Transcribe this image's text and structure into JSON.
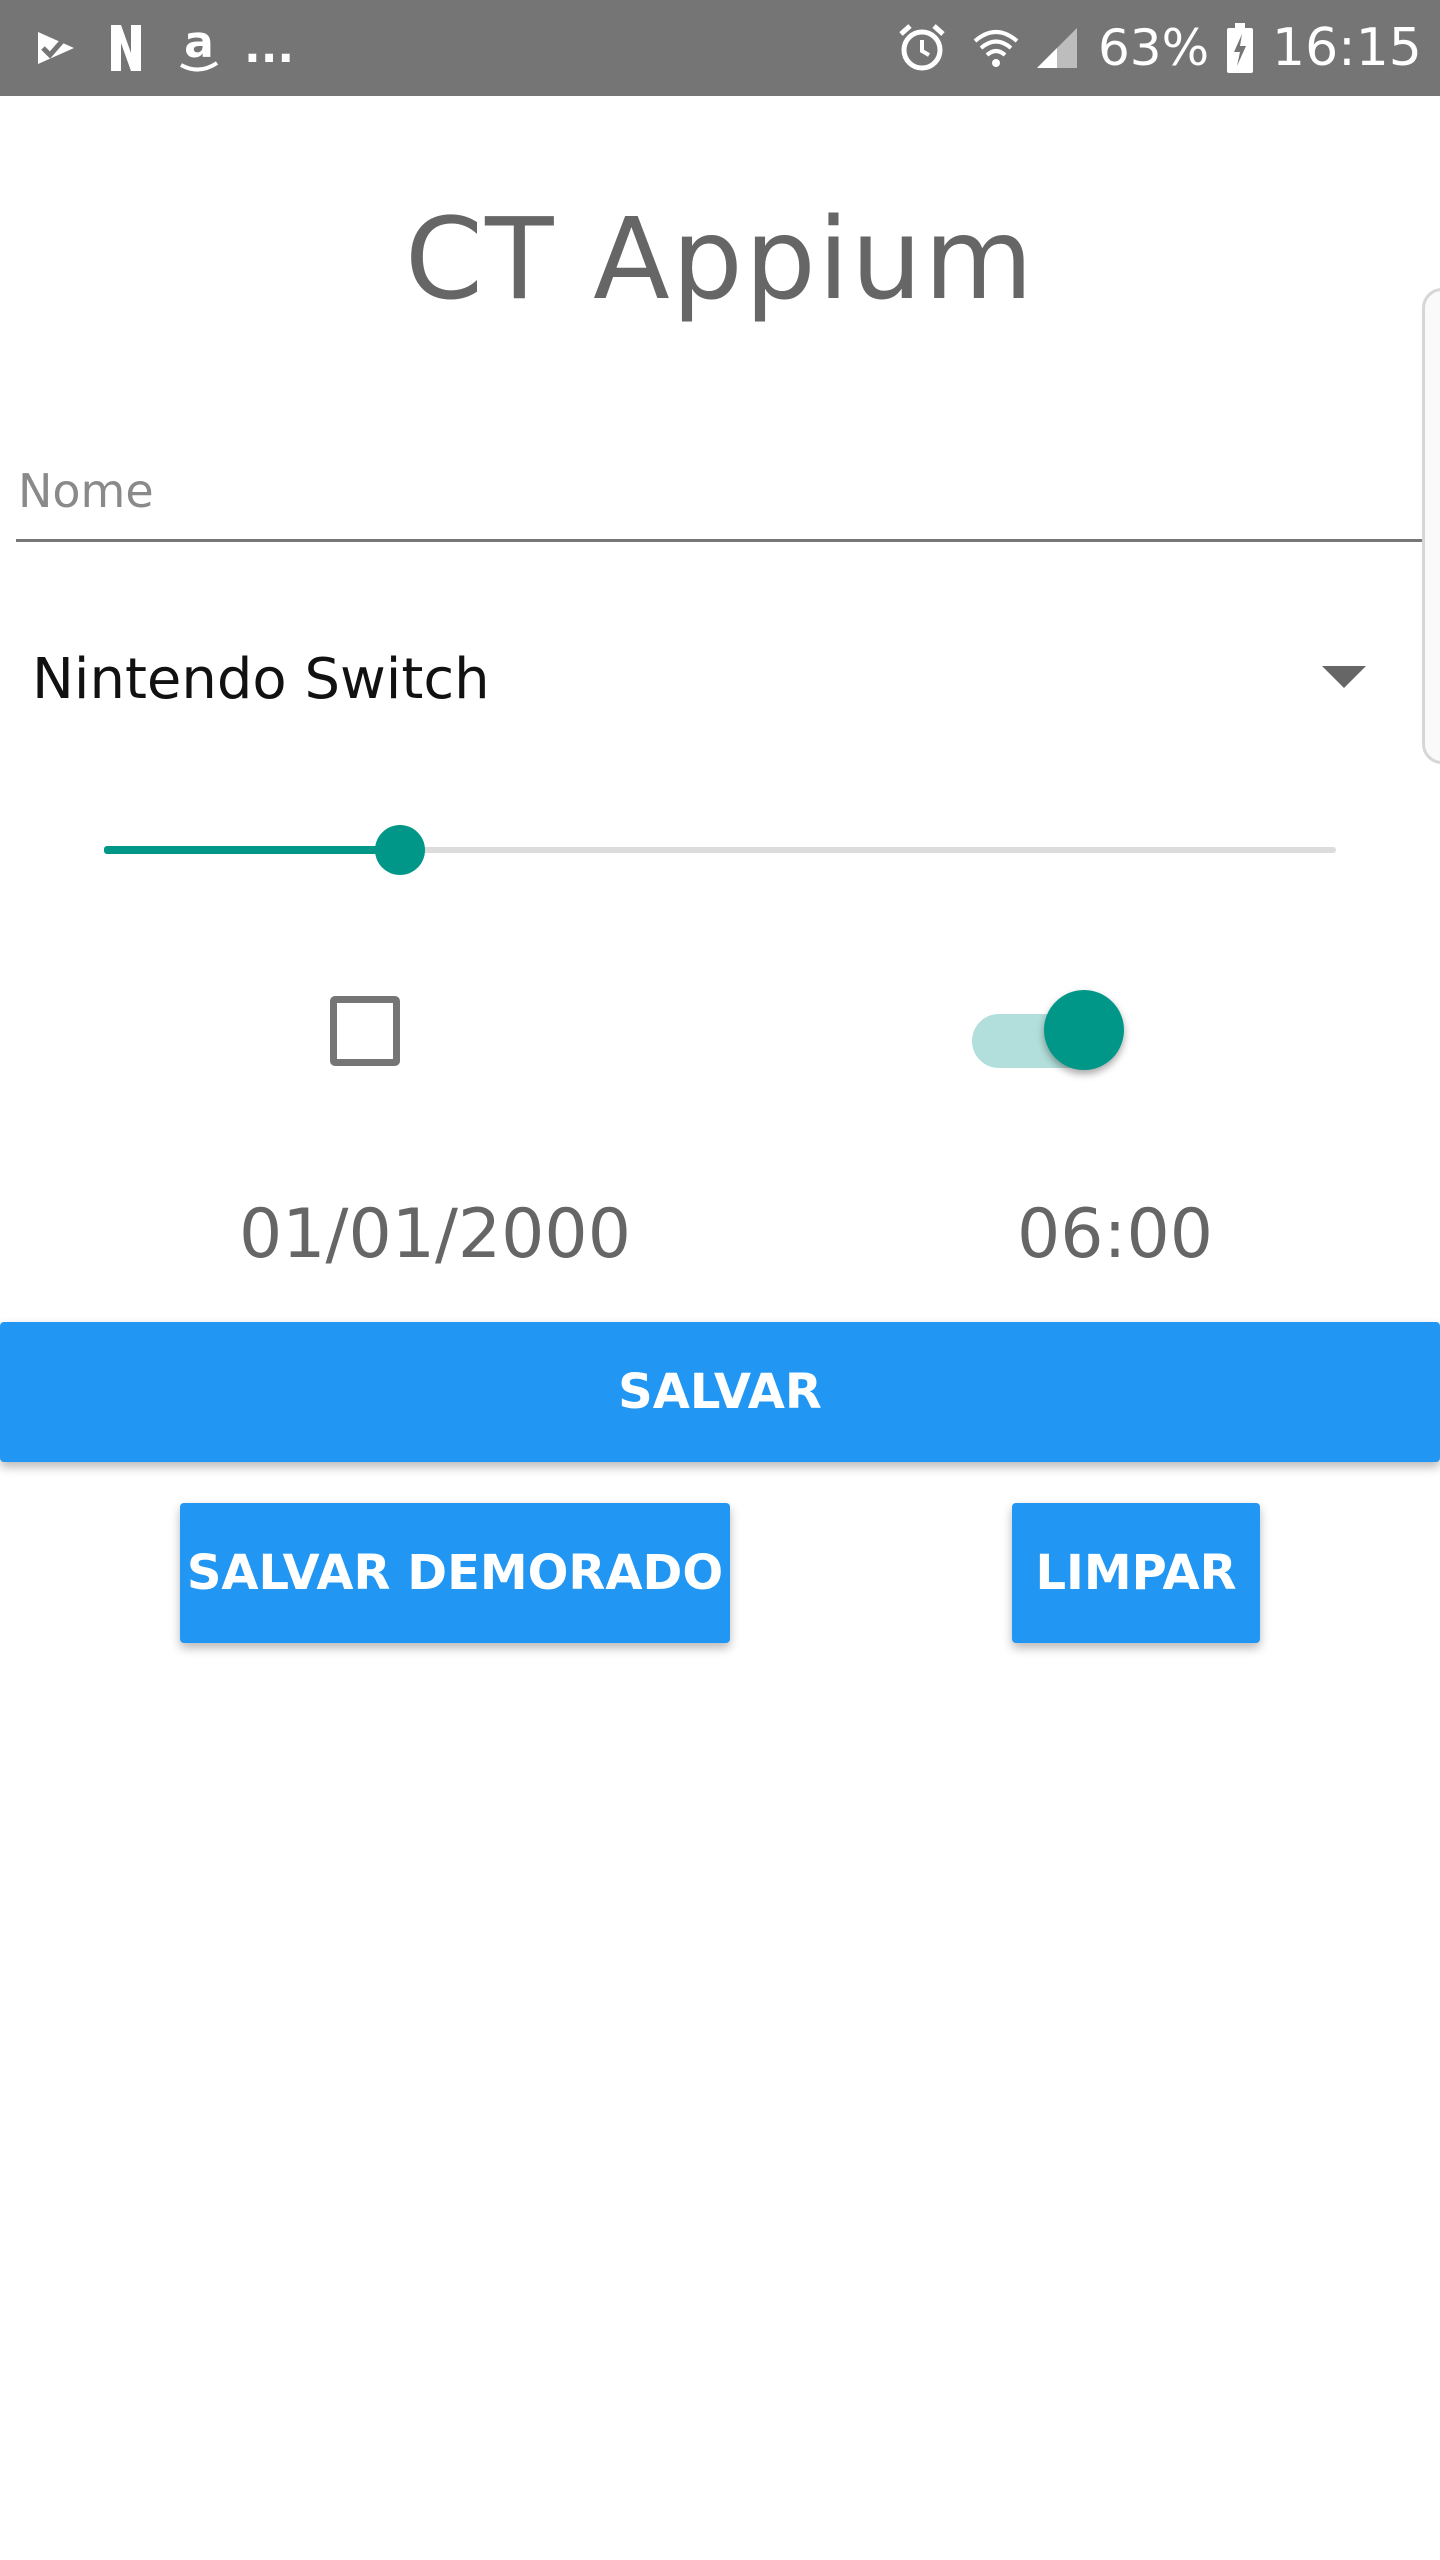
{
  "status_bar": {
    "notification_icons": [
      "check-notification-icon",
      "n-app-icon",
      "amazon-icon"
    ],
    "more_indicator": "...",
    "alarm_icon": "alarm-icon",
    "wifi_icon": "wifi-icon",
    "signal_icon": "signal-icon",
    "battery_percent": "63%",
    "battery_icon": "battery-charging-icon",
    "time": "16:15",
    "background_color": "#757575"
  },
  "app": {
    "title": "CT Appium"
  },
  "form": {
    "name_placeholder": "Nome",
    "name_value": "",
    "console_selected": "Nintendo Switch",
    "slider_fraction": 0.24,
    "checkbox_checked": false,
    "switch_on": true,
    "date": "01/01/2000",
    "time": "06:00"
  },
  "buttons": {
    "save": "SALVAR",
    "save_delayed": "SALVAR DEMORADO",
    "clear": "LIMPAR"
  },
  "colors": {
    "accent": "#009688",
    "accent_light": "#b2dfdb",
    "button": "#2196f3",
    "title_text": "#666666"
  }
}
